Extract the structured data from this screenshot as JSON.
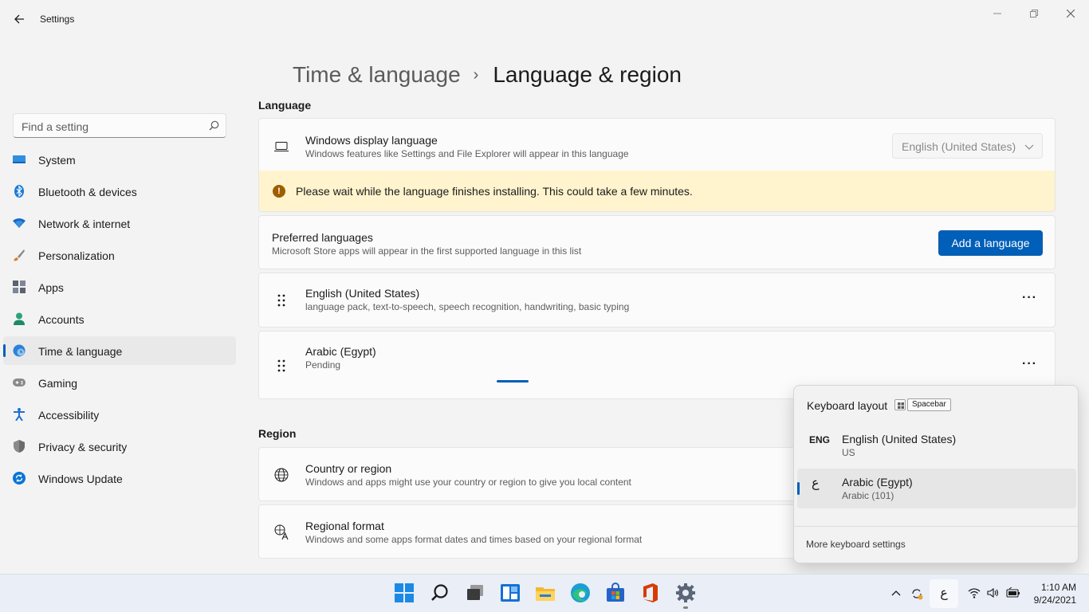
{
  "window": {
    "title": "Settings",
    "back_icon": "arrow-left-icon",
    "controls": [
      "minimize-icon",
      "maximize-icon",
      "close-icon"
    ]
  },
  "sidebar": {
    "search_placeholder": "Find a setting",
    "items": [
      {
        "label": "System",
        "icon": "monitor-icon",
        "color": "#0078d4",
        "active": false
      },
      {
        "label": "Bluetooth & devices",
        "icon": "bluetooth-icon",
        "color": "#0078d4",
        "active": false
      },
      {
        "label": "Network & internet",
        "icon": "wifi-icon",
        "color": "#0a64c8",
        "active": false
      },
      {
        "label": "Personalization",
        "icon": "brush-icon",
        "color": "#d87a2a",
        "active": false
      },
      {
        "label": "Apps",
        "icon": "apps-icon",
        "color": "#5b6270",
        "active": false
      },
      {
        "label": "Accounts",
        "icon": "person-icon",
        "color": "#2aa37a",
        "active": false
      },
      {
        "label": "Time & language",
        "icon": "globe-clock-icon",
        "color": "#2b83d9",
        "active": true
      },
      {
        "label": "Gaming",
        "icon": "gamepad-icon",
        "color": "#7a7a7a",
        "active": false
      },
      {
        "label": "Accessibility",
        "icon": "accessibility-icon",
        "color": "#1f6fd1",
        "active": false
      },
      {
        "label": "Privacy & security",
        "icon": "shield-icon",
        "color": "#7a7a7a",
        "active": false
      },
      {
        "label": "Windows Update",
        "icon": "update-icon",
        "color": "#0a75d6",
        "active": false
      }
    ]
  },
  "breadcrumb": {
    "parent": "Time & language",
    "separator": "›",
    "current": "Language & region"
  },
  "language_section": {
    "title": "Language",
    "display_language": {
      "title": "Windows display language",
      "description": "Windows features like Settings and File Explorer will appear in this language",
      "value": "English (United States)"
    },
    "warning": {
      "text": "Please wait while the language finishes installing. This could take a few minutes.",
      "icon_glyph": "!"
    },
    "preferred": {
      "title": "Preferred languages",
      "description": "Microsoft Store apps will appear in the first supported language in this list",
      "add_button": "Add a language"
    },
    "languages": [
      {
        "name": "English (United States)",
        "details": "language pack, text-to-speech, speech recognition, handwriting, basic typing",
        "more": "···"
      },
      {
        "name": "Arabic (Egypt)",
        "details": "Pending",
        "more": "···"
      }
    ]
  },
  "region_section": {
    "title": "Region",
    "country": {
      "title": "Country or region",
      "description": "Windows and apps might use your country or region to give you local content"
    },
    "format": {
      "title": "Regional format",
      "description": "Windows and some apps format dates and times based on your regional format"
    }
  },
  "keyboard_flyout": {
    "title": "Keyboard layout",
    "shortcut_key": "Spacebar",
    "layouts": [
      {
        "code": "ENG",
        "name": "English (United States)",
        "layout": "US",
        "selected": false
      },
      {
        "code": "ع",
        "name": "Arabic (Egypt)",
        "layout": "Arabic (101)",
        "selected": true
      }
    ],
    "more_link": "More keyboard settings"
  },
  "taskbar": {
    "apps": [
      "start-icon",
      "search-icon",
      "task-view-icon",
      "widgets-icon",
      "file-explorer-icon",
      "edge-icon",
      "store-icon",
      "office-icon",
      "settings-icon"
    ],
    "ime_glyph": "ع",
    "time": "1:10 AM",
    "date": "9/24/2021"
  }
}
